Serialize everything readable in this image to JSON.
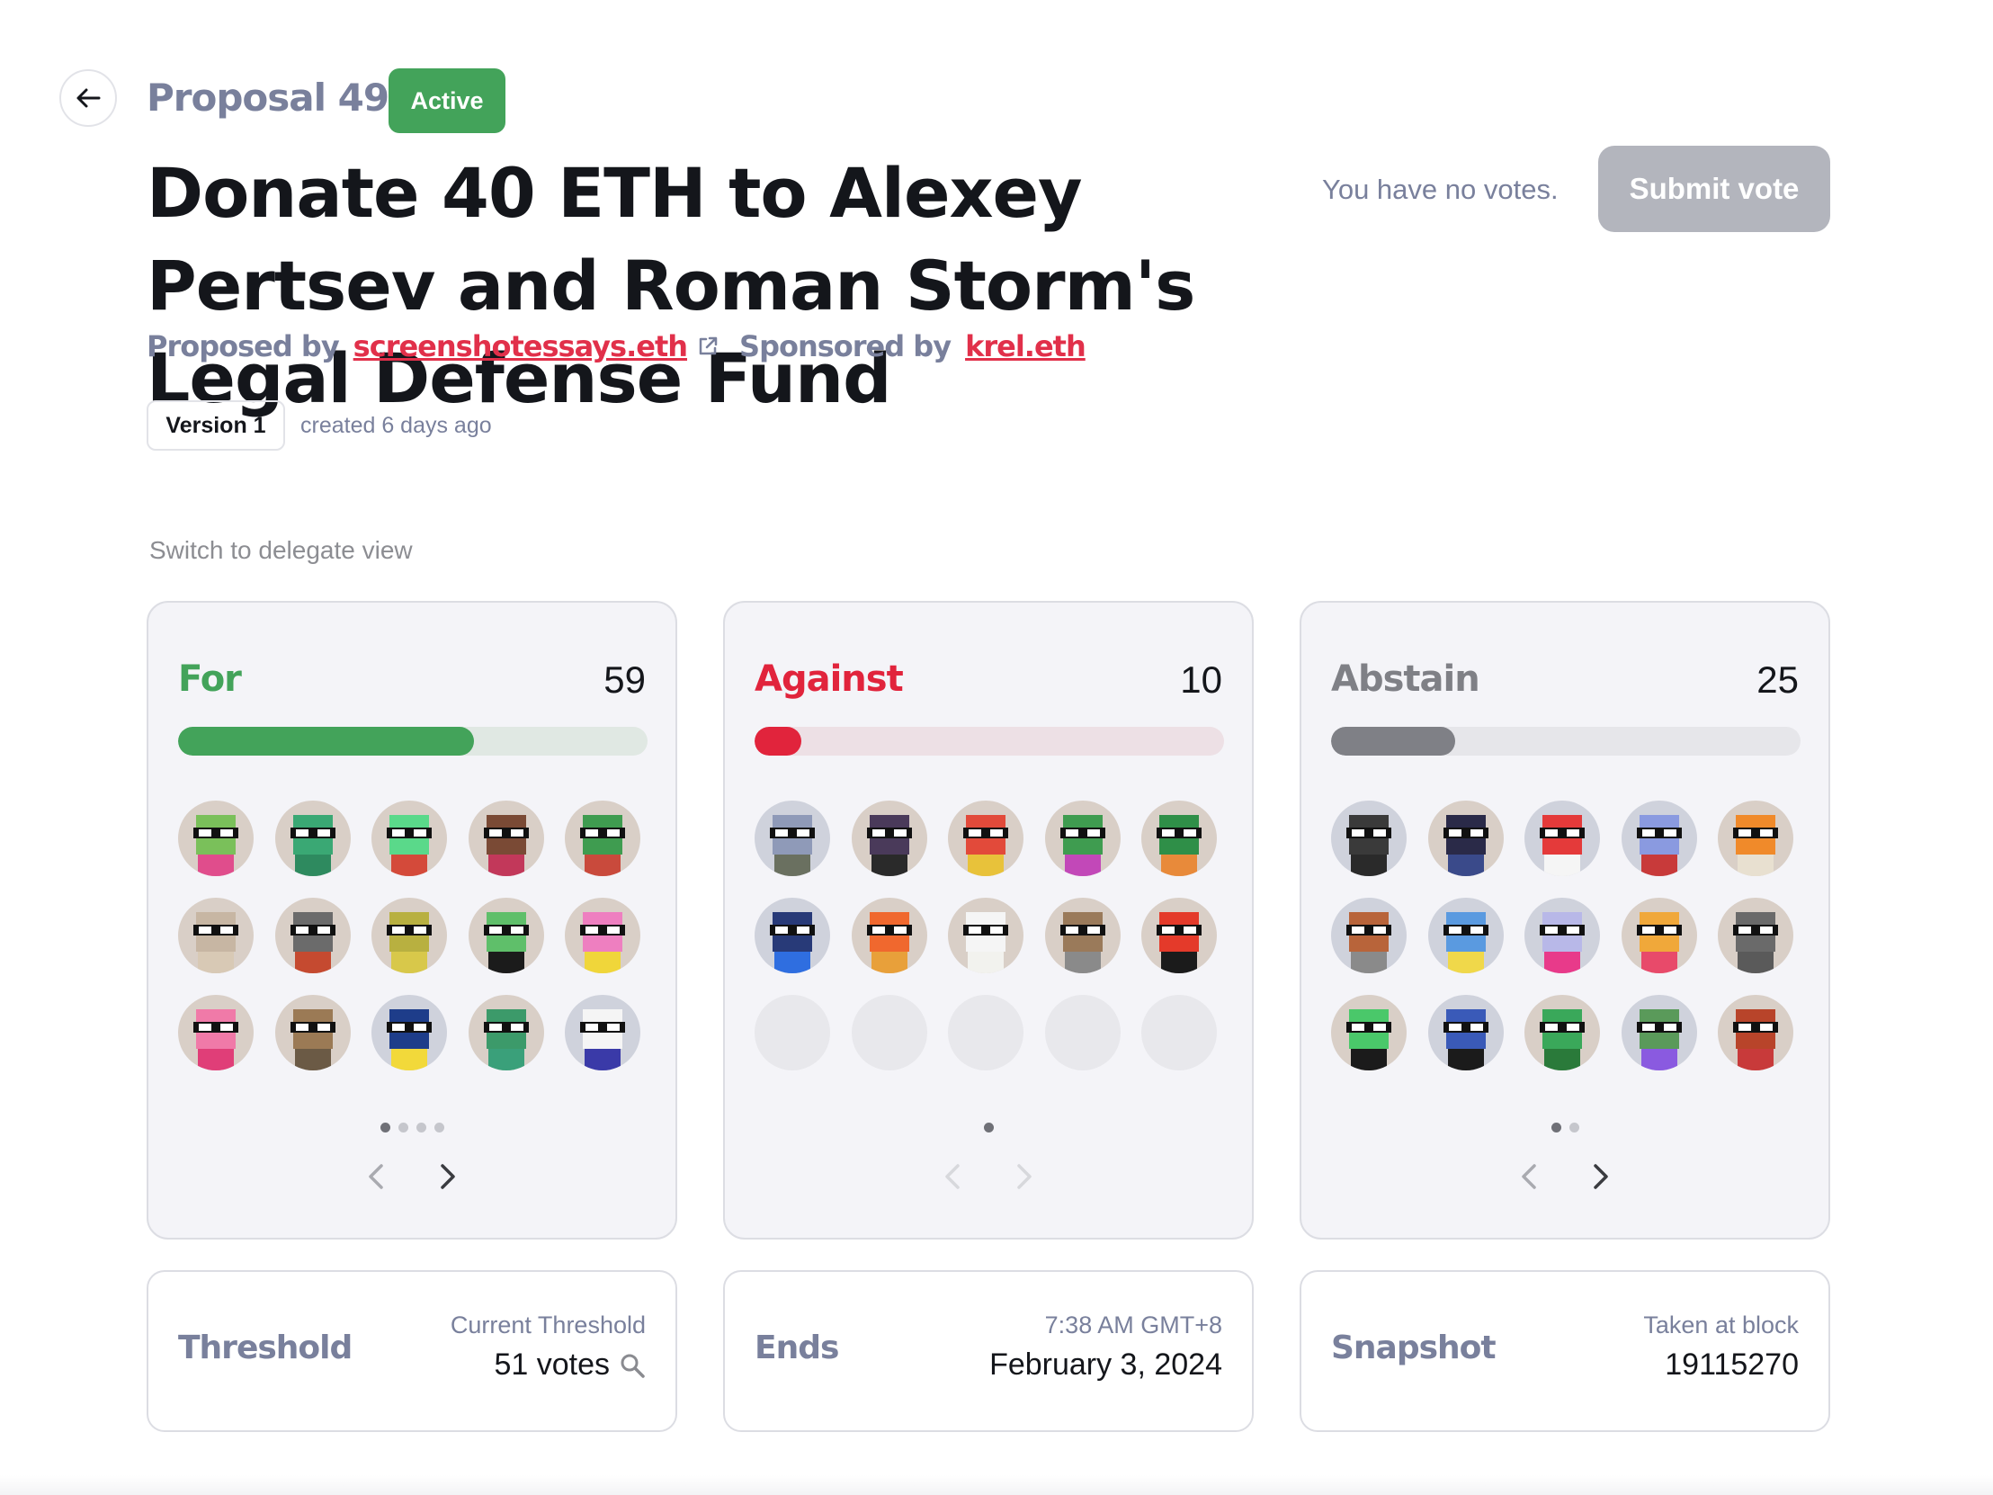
{
  "header": {
    "proposal_number": "Proposal 493",
    "status_badge": "Active",
    "title": "Donate 40 ETH to Alexey Pertsev and Roman Storm's Legal Defense Fund",
    "proposed_by_label": "Proposed by",
    "proposer": "screenshotessays.eth",
    "sponsored_by_label": "Sponsored by",
    "sponsor": "krel.eth",
    "version_label": "Version 1",
    "created_text": "created 6 days ago",
    "no_votes_text": "You have no votes.",
    "submit_label": "Submit vote"
  },
  "switch_view_label": "Switch to delegate view",
  "vote_cards": [
    {
      "label": "For",
      "count": "59",
      "progress": 0.63,
      "color": "#43a35a",
      "track": "#e0e8e3",
      "pages": 4,
      "active_page": 1,
      "avatars": [
        {
          "bg": "#d9cfc7",
          "head": "#7ac05a",
          "body": "#e04d8c"
        },
        {
          "bg": "#d9cfc7",
          "head": "#3aa874",
          "body": "#2e8a5f"
        },
        {
          "bg": "#d9cfc7",
          "head": "#5ad98a",
          "body": "#d44a3a"
        },
        {
          "bg": "#d9cfc7",
          "head": "#7a4a35",
          "body": "#c2385a"
        },
        {
          "bg": "#d9cfc7",
          "head": "#3f9c50",
          "body": "#c94a3c"
        },
        {
          "bg": "#d9cfc7",
          "head": "#c7b6a3",
          "body": "#d8c9b5"
        },
        {
          "bg": "#d9cfc7",
          "head": "#6b6b6b",
          "body": "#c54a30"
        },
        {
          "bg": "#d9cfc7",
          "head": "#b8b040",
          "body": "#d8c84a"
        },
        {
          "bg": "#d9cfc7",
          "head": "#5fbf6a",
          "body": "#1b1b1b"
        },
        {
          "bg": "#d9cfc7",
          "head": "#ee7fc0",
          "body": "#f0d63a"
        },
        {
          "bg": "#d9cfc7",
          "head": "#f07aa8",
          "body": "#e03e78"
        },
        {
          "bg": "#d9cfc7",
          "head": "#9b7a55",
          "body": "#6b5a45"
        },
        {
          "bg": "#cfd2dc",
          "head": "#1e3d8a",
          "body": "#f2d93a"
        },
        {
          "bg": "#d9cfc7",
          "head": "#3c9a6a",
          "body": "#3aa07a"
        },
        {
          "bg": "#cfd2dc",
          "head": "#f5f5f5",
          "body": "#3a3aa8"
        }
      ]
    },
    {
      "label": "Against",
      "count": "10",
      "progress": 0.1,
      "color": "#e1243c",
      "track": "#ede0e5",
      "pages": 1,
      "active_page": 1,
      "avatars": [
        {
          "bg": "#cfd2dc",
          "head": "#8f9ab8",
          "body": "#6a7060"
        },
        {
          "bg": "#d9cfc7",
          "head": "#4a3a5a",
          "body": "#2a2a2a"
        },
        {
          "bg": "#d9cfc7",
          "head": "#e24a3a",
          "body": "#e8c23a"
        },
        {
          "bg": "#d9cfc7",
          "head": "#3f9c50",
          "body": "#c248b8"
        },
        {
          "bg": "#d9cfc7",
          "head": "#2f8f48",
          "body": "#e88a3a"
        },
        {
          "bg": "#cfd2dc",
          "head": "#283a78",
          "body": "#2f6ee0"
        },
        {
          "bg": "#d9cfc7",
          "head": "#f0682e",
          "body": "#e8a03a"
        },
        {
          "bg": "#d9cfc7",
          "head": "#f5f5f5",
          "body": "#f2f2ee"
        },
        {
          "bg": "#d9cfc7",
          "head": "#9a7a5a",
          "body": "#8a8a8a"
        },
        {
          "bg": "#d9cfc7",
          "head": "#e43a2a",
          "body": "#1b1b1b"
        },
        {
          "empty": true
        },
        {
          "empty": true
        },
        {
          "empty": true
        },
        {
          "empty": true
        },
        {
          "empty": true
        }
      ]
    },
    {
      "label": "Abstain",
      "count": "25",
      "progress": 0.265,
      "color": "#7f8086",
      "track": "#e6e6ea",
      "pages": 2,
      "active_page": 1,
      "avatars": [
        {
          "bg": "#cfd2dc",
          "head": "#3a3a3a",
          "body": "#2a2a2a"
        },
        {
          "bg": "#d9cfc7",
          "head": "#2a2a48",
          "body": "#3a4a8a"
        },
        {
          "bg": "#cfd2dc",
          "head": "#e43a3a",
          "body": "#f5f5f5"
        },
        {
          "bg": "#cfd2dc",
          "head": "#8a9ae0",
          "body": "#c83a3a"
        },
        {
          "bg": "#d9cfc7",
          "head": "#f08a2a",
          "body": "#e8e0d0"
        },
        {
          "bg": "#cfd2dc",
          "head": "#b8643a",
          "body": "#8a8a8a"
        },
        {
          "bg": "#cfd2dc",
          "head": "#5a9ae0",
          "body": "#f0d84a"
        },
        {
          "bg": "#cfd2dc",
          "head": "#b8b8e8",
          "body": "#e83a8a"
        },
        {
          "bg": "#d9cfc7",
          "head": "#f0a83a",
          "body": "#e84a6a"
        },
        {
          "bg": "#d9cfc7",
          "head": "#6a6a6a",
          "body": "#5a5a5a"
        },
        {
          "bg": "#d9cfc7",
          "head": "#4ac86a",
          "body": "#1b1b1b"
        },
        {
          "bg": "#cfd2dc",
          "head": "#3a5ab8",
          "body": "#1b1b1b"
        },
        {
          "bg": "#d9cfc7",
          "head": "#3aa85a",
          "body": "#2a7a3a"
        },
        {
          "bg": "#cfd2dc",
          "head": "#5a9a5a",
          "body": "#8a5ae0"
        },
        {
          "bg": "#d9cfc7",
          "head": "#b8442a",
          "body": "#c83a3a"
        }
      ]
    }
  ],
  "info_cards": [
    {
      "label": "Threshold",
      "sub": "Current Threshold",
      "value": "51 votes",
      "icon": "search-icon"
    },
    {
      "label": "Ends",
      "sub": "7:38 AM GMT+8",
      "value": "February 3, 2024"
    },
    {
      "label": "Snapshot",
      "sub": "Taken at block",
      "value": "19115270"
    }
  ]
}
